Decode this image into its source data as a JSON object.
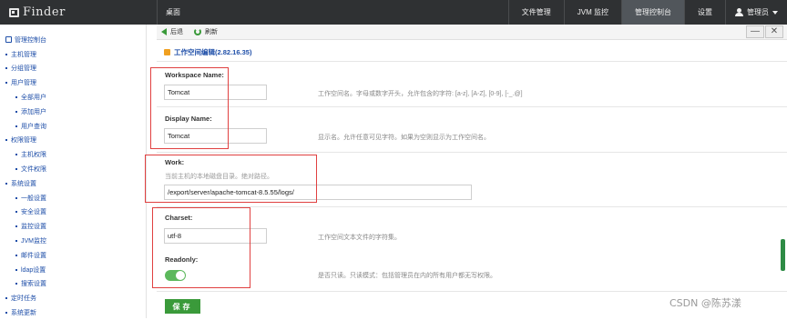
{
  "app": {
    "title": "Finder"
  },
  "topnav": {
    "left_item": "桌面",
    "items": [
      {
        "label": "文件管理",
        "active": false
      },
      {
        "label": "JVM 监控",
        "active": false
      },
      {
        "label": "管理控制台",
        "active": true
      },
      {
        "label": "设置",
        "active": false
      }
    ],
    "user_label": "管理员"
  },
  "sidebar": {
    "root": "管理控制台",
    "items": [
      {
        "label": "主机管理",
        "level": 1
      },
      {
        "label": "分组管理",
        "level": 1
      },
      {
        "label": "用户管理",
        "level": 1
      },
      {
        "label": "全部用户",
        "level": 2
      },
      {
        "label": "添加用户",
        "level": 2
      },
      {
        "label": "用户查询",
        "level": 2
      },
      {
        "label": "权限管理",
        "level": 1
      },
      {
        "label": "主机权限",
        "level": 2
      },
      {
        "label": "文件权限",
        "level": 2
      },
      {
        "label": "系统设置",
        "level": 1
      },
      {
        "label": "一般设置",
        "level": 2
      },
      {
        "label": "安全设置",
        "level": 2
      },
      {
        "label": "监控设置",
        "level": 2
      },
      {
        "label": "JVM监控",
        "level": 2
      },
      {
        "label": "邮件设置",
        "level": 2
      },
      {
        "label": "ldap设置",
        "level": 2
      },
      {
        "label": "搜索设置",
        "level": 2
      },
      {
        "label": "定时任务",
        "level": 1
      },
      {
        "label": "系统更新",
        "level": 1
      }
    ]
  },
  "toolbar": {
    "back_label": "后退",
    "refresh_label": "刷新",
    "minimize_label": "—",
    "close_label": "✕"
  },
  "panel": {
    "title": "工作空间编辑(2.82.16.35)"
  },
  "form": {
    "workspace_name": {
      "label": "Workspace Name:",
      "value": "Tomcat",
      "desc": "工作空间名。字母或数字开头，允许包含的字符: [a-z], [A-Z], [0-9], [-_.@]"
    },
    "display_name": {
      "label": "Display Name:",
      "value": "Tomcat",
      "desc": "显示名。允许任意可见字符。如果为空则显示为工作空间名。"
    },
    "work": {
      "label": "Work:",
      "hint": "当前主机的本地磁盘目录。绝对路径。",
      "value": "/export/server/apache-tomcat-8.5.55/logs/"
    },
    "charset": {
      "label": "Charset:",
      "value": "utf-8",
      "desc": "工作空间文本文件的字符集。"
    },
    "readonly": {
      "label": "Readonly:",
      "on": true,
      "desc": "是否只读。只读模式：包括管理员在内的所有用户都无写权限。"
    },
    "save_label": "保存"
  },
  "watermark": "CSDN @陈苏漾"
}
